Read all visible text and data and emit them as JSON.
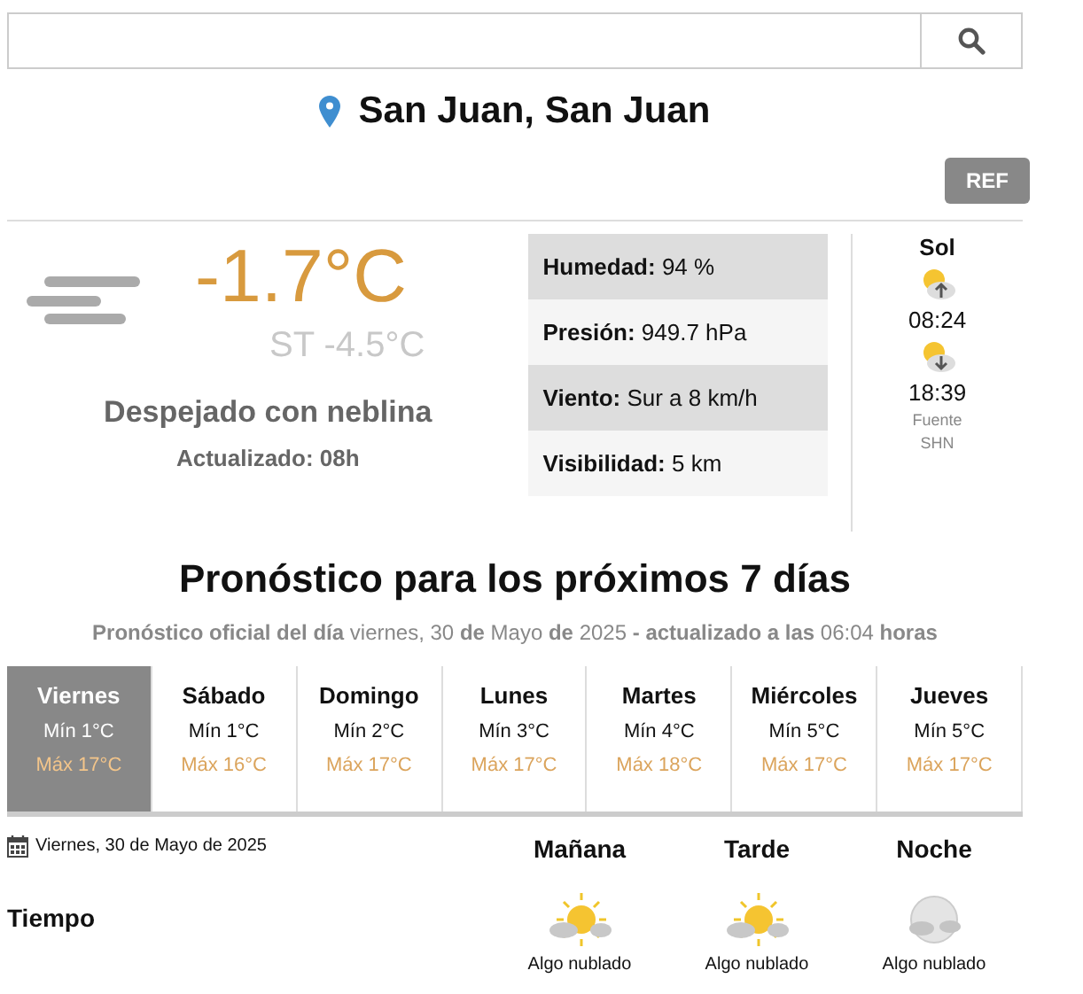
{
  "location": "San Juan, San Juan",
  "ref_button": "REF",
  "current": {
    "temperature": "-1.7°C",
    "feels_like": "ST -4.5°C",
    "condition": "Despejado con neblina",
    "updated": "Actualizado: 08h"
  },
  "details": [
    {
      "label": "Humedad:",
      "value": "94 %"
    },
    {
      "label": "Presión:",
      "value": "949.7 hPa"
    },
    {
      "label": "Viento:",
      "value": "Sur a 8 km/h"
    },
    {
      "label": "Visibilidad:",
      "value": "5 km"
    }
  ],
  "sun": {
    "title": "Sol",
    "sunrise": "08:24",
    "sunset": "18:39",
    "source": "Fuente",
    "source_name": "SHN"
  },
  "forecast": {
    "title": "Pronóstico para los próximos 7 días",
    "subtitle": "**Pronóstico oficial del día** viernes, 30 **de** Mayo **de** 2025 **- actualizado a las** 06:04 **horas**",
    "days": [
      {
        "name": "Viernes",
        "min": "Mín 1°C",
        "max": "Máx 17°C",
        "selected": true
      },
      {
        "name": "Sábado",
        "min": "Mín 1°C",
        "max": "Máx 16°C",
        "selected": false
      },
      {
        "name": "Domingo",
        "min": "Mín 2°C",
        "max": "Máx 17°C",
        "selected": false
      },
      {
        "name": "Lunes",
        "min": "Mín 3°C",
        "max": "Máx 17°C",
        "selected": false
      },
      {
        "name": "Martes",
        "min": "Mín 4°C",
        "max": "Máx 18°C",
        "selected": false
      },
      {
        "name": "Miércoles",
        "min": "Mín 5°C",
        "max": "Máx 17°C",
        "selected": false
      },
      {
        "name": "Jueves",
        "min": "Mín 5°C",
        "max": "Máx 17°C",
        "selected": false
      }
    ]
  },
  "day_detail": {
    "date": "Viernes, 30 de Mayo de 2025",
    "row_label": "Tiempo",
    "periods": [
      {
        "name": "Mañana",
        "sky": "Algo nublado",
        "kind": "sun_cloud"
      },
      {
        "name": "Tarde",
        "sky": "Algo nublado",
        "kind": "sun_cloud"
      },
      {
        "name": "Noche",
        "sky": "Algo nublado",
        "kind": "moon_cloud"
      }
    ]
  }
}
